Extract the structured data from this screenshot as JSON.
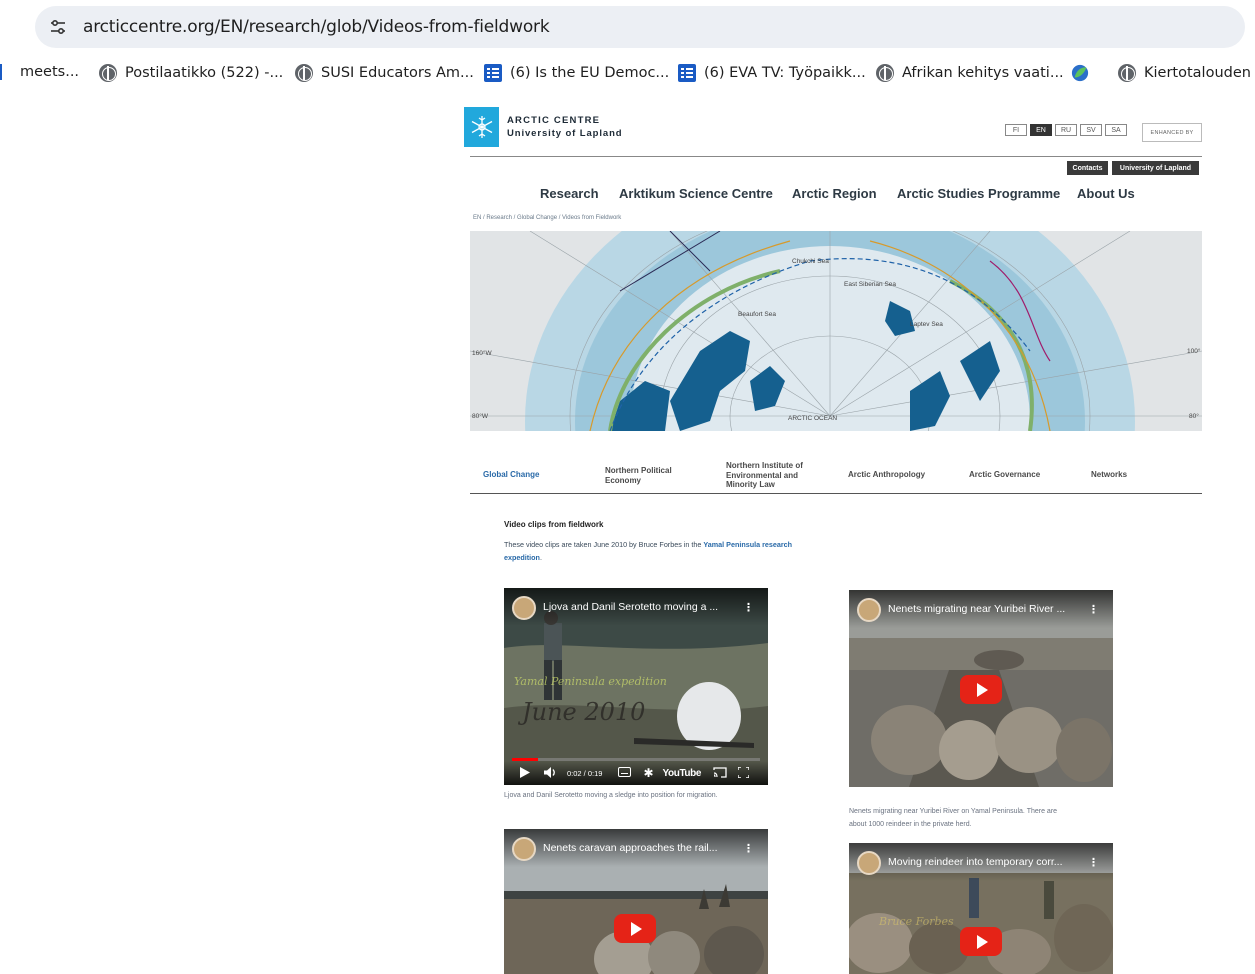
{
  "browser": {
    "url": "arcticcentre.org/EN/research/glob/Videos-from-fieldwork",
    "bookmarks": [
      {
        "label": "meets...",
        "icon": "partial-icon"
      },
      {
        "label": "Postilaatikko (522) -...",
        "icon": "globe-icon"
      },
      {
        "label": "SUSI Educators Am...",
        "icon": "globe-icon"
      },
      {
        "label": "(6) Is the EU Democ...",
        "icon": "list-icon"
      },
      {
        "label": "(6) EVA TV: Työpaikk...",
        "icon": "list-icon"
      },
      {
        "label": "Afrikan kehitys vaati...",
        "icon": "globe-icon"
      },
      {
        "label": "",
        "icon": "leaf-icon"
      },
      {
        "label": "Kiertotalouden",
        "icon": "globe-icon"
      }
    ]
  },
  "site": {
    "name_line1": "ARCTIC CENTRE",
    "name_line2": "University of Lapland",
    "languages": [
      "FI",
      "EN",
      "RU",
      "SV",
      "SA"
    ],
    "active_language": "EN",
    "enhanced_by": "ENHANCED BY",
    "top_links": [
      "Contacts",
      "University of Lapland"
    ],
    "main_nav": [
      "Research",
      "Arktikum Science Centre",
      "Arctic Region",
      "Arctic Studies Programme",
      "About Us"
    ],
    "breadcrumb": "EN / Research / Global Change / Videos from Fieldwork",
    "map_labels": [
      "Chukchi Sea",
      "East Siberian Sea",
      "Beaufort Sea",
      "Laptev Sea",
      "ARCTIC OCEAN",
      "160°W",
      "100°",
      "80°W",
      "80°"
    ],
    "sub_nav": [
      {
        "label": "Global Change",
        "active": true
      },
      {
        "label": "Northern Political Economy",
        "active": false
      },
      {
        "label": "Northern Institute of Environmental and Minority Law",
        "active": false
      },
      {
        "label": "Arctic Anthropology",
        "active": false
      },
      {
        "label": "Arctic Governance",
        "active": false
      },
      {
        "label": "Networks",
        "active": false
      }
    ]
  },
  "content": {
    "title": "Video clips from fieldwork",
    "intro_text": "These video clips are taken June 2010 by Bruce Forbes in the",
    "intro_link": "Yamal Peninsula research expedition",
    "intro_end": ".",
    "videos": [
      {
        "title": "Ljova and Danil Serotetto moving a ...",
        "overlay_line1": "Yamal Peninsula expedition",
        "overlay_line2": "June 2010",
        "time": "0:02 / 0:19",
        "progress": 0.105,
        "caption": "Ljova and Danil Serotetto moving a sledge into position for migration."
      },
      {
        "title": "Nenets migrating near Yuribei River ...",
        "caption": "Nenets migrating near Yuribei River on Yamal Peninsula. There are about 1000 reindeer in the private herd."
      },
      {
        "title": "Nenets caravan approaches the rail..."
      },
      {
        "title": "Moving reindeer into temporary corr...",
        "overlay_line1": "Bruce Forbes"
      }
    ],
    "youtube_label": "YouTube"
  }
}
